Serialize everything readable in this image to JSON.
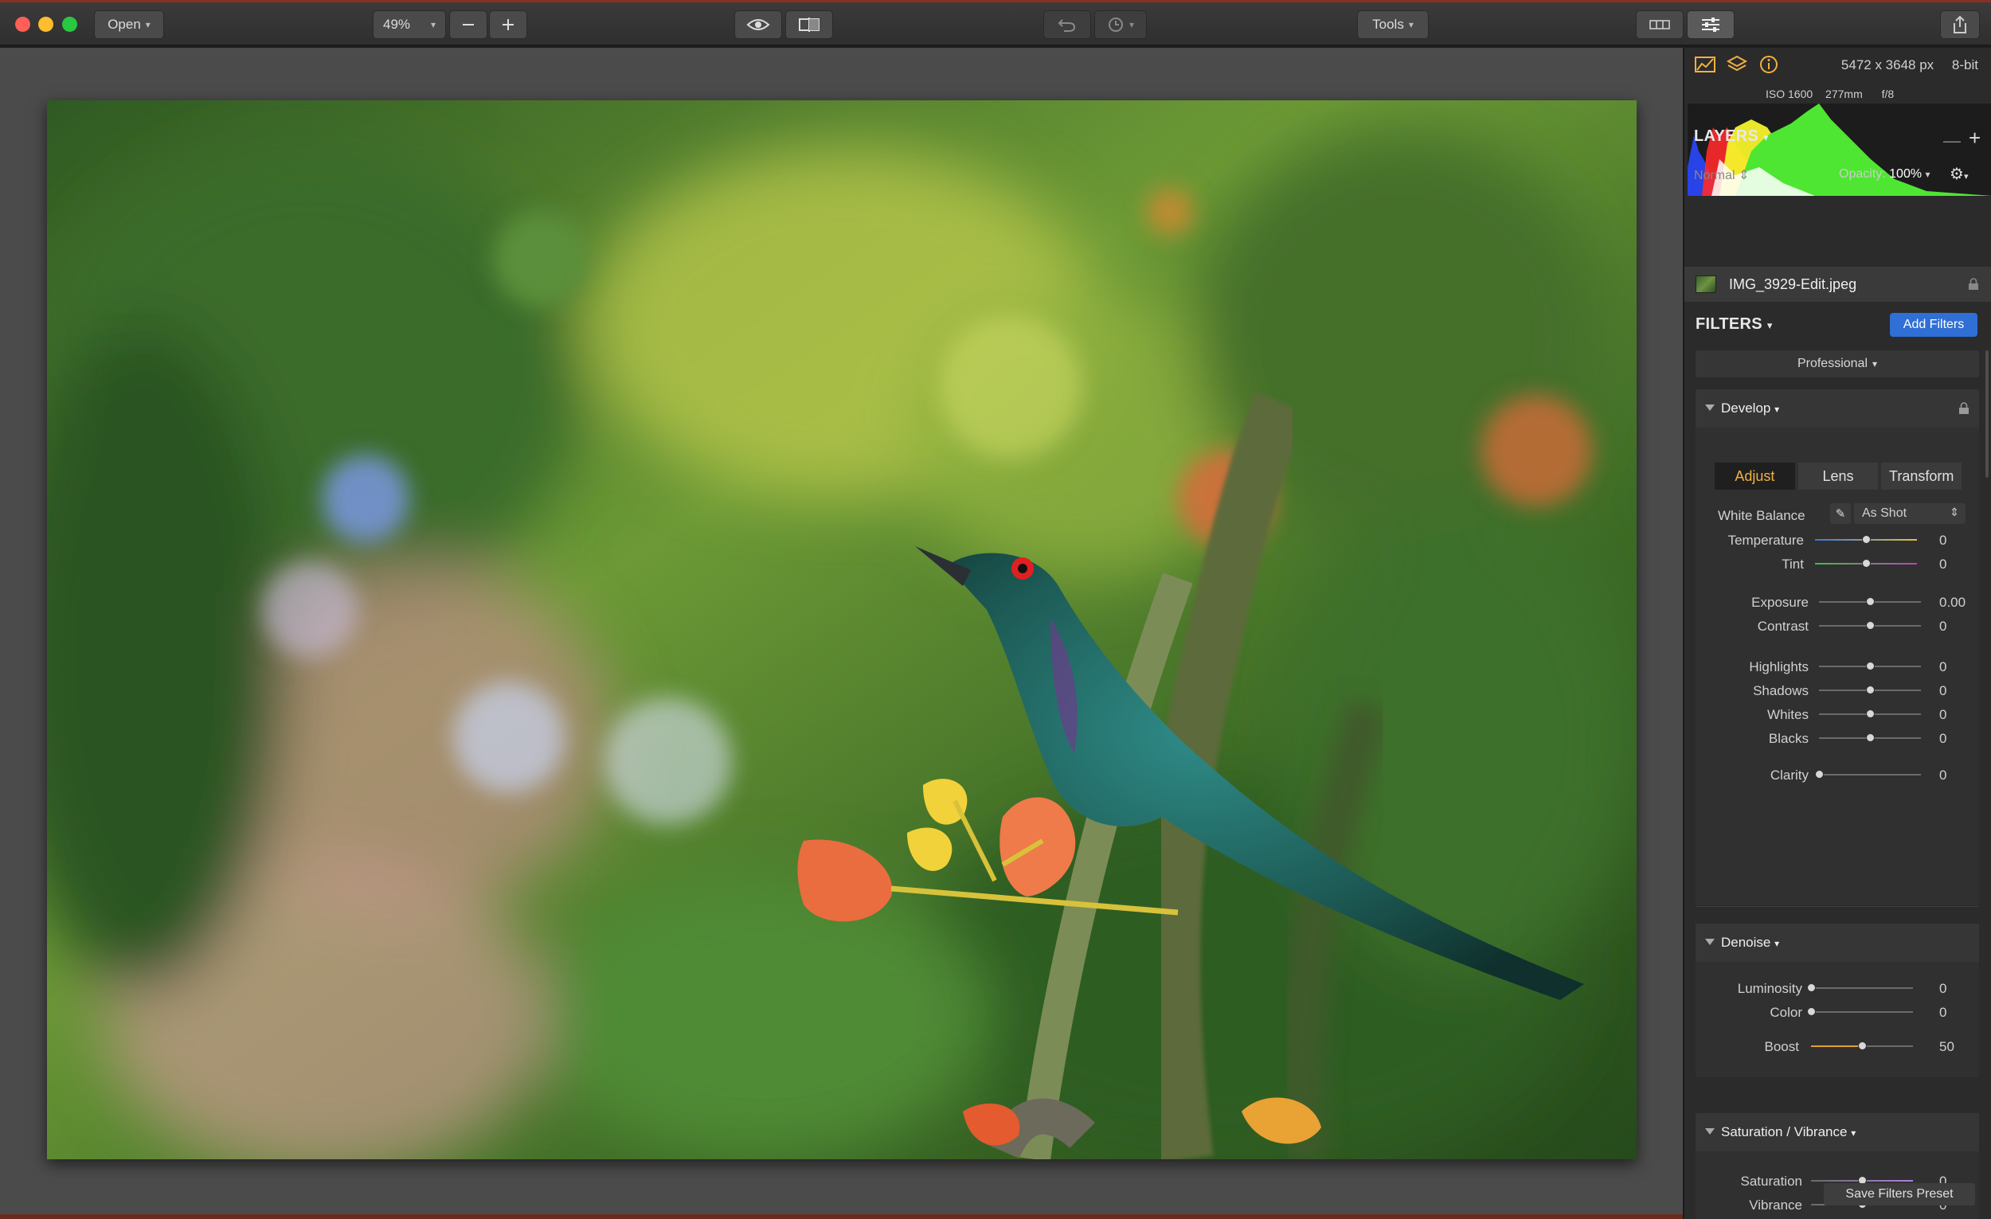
{
  "toolbar": {
    "open_label": "Open",
    "zoom_value": "49%",
    "tools_label": "Tools"
  },
  "info": {
    "dimensions": "5472 x 3648 px",
    "bit_depth": "8-bit",
    "iso": "ISO 1600",
    "focal_length": "277mm",
    "aperture": "f/8"
  },
  "layers": {
    "title": "LAYERS",
    "blend_mode": "Normal",
    "opacity_label": "Opacity:",
    "opacity_value": "100%",
    "items": [
      {
        "name": "IMG_3929-Edit.jpeg"
      }
    ]
  },
  "filters": {
    "title": "FILTERS",
    "add_label": "Add Filters",
    "workspace": "Professional"
  },
  "develop": {
    "title": "Develop",
    "tabs": [
      "Adjust",
      "Lens",
      "Transform"
    ],
    "selected_tab": "Adjust",
    "white_balance_label": "White Balance",
    "white_balance_value": "As Shot",
    "sliders": [
      {
        "label": "Temperature",
        "value": "0",
        "level": 0.5
      },
      {
        "label": "Tint",
        "value": "0",
        "level": 0.5
      },
      {
        "label": "Exposure",
        "value": "0.00",
        "level": 0.5
      },
      {
        "label": "Contrast",
        "value": "0",
        "level": 0.5
      },
      {
        "label": "Highlights",
        "value": "0",
        "level": 0.5
      },
      {
        "label": "Shadows",
        "value": "0",
        "level": 0.5
      },
      {
        "label": "Whites",
        "value": "0",
        "level": 0.5
      },
      {
        "label": "Blacks",
        "value": "0",
        "level": 0.5
      },
      {
        "label": "Clarity",
        "value": "0",
        "level": 0.0
      }
    ]
  },
  "denoise": {
    "title": "Denoise",
    "sliders": [
      {
        "label": "Luminosity",
        "value": "0",
        "level": 0.0
      },
      {
        "label": "Color",
        "value": "0",
        "level": 0.0
      },
      {
        "label": "Boost",
        "value": "50",
        "level": 0.5
      }
    ]
  },
  "saturation_vibrance": {
    "title": "Saturation / Vibrance",
    "sliders": [
      {
        "label": "Saturation",
        "value": "0",
        "level": 0.5
      },
      {
        "label": "Vibrance",
        "value": "0",
        "level": 0.5
      }
    ]
  },
  "footer": {
    "save_preset_label": "Save Filters Preset"
  },
  "colors": {
    "accent_blue": "#2f6fd6",
    "selected_tab_text": "#f0b040"
  }
}
